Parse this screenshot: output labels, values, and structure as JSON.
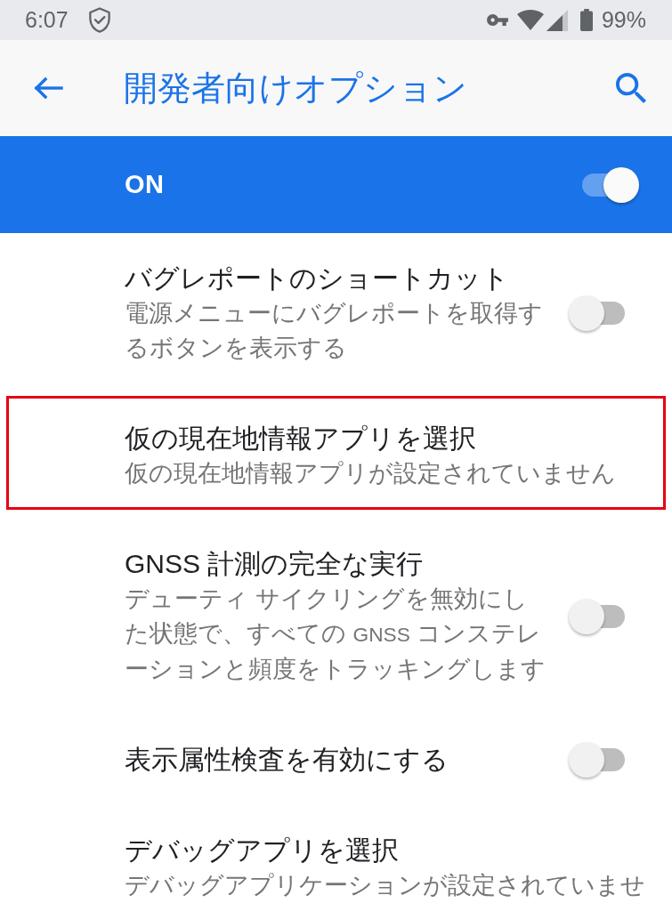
{
  "status_bar": {
    "time": "6:07",
    "battery": "99%"
  },
  "app_bar": {
    "title": "開発者向けオプション"
  },
  "master_switch": {
    "label": "ON",
    "on": true
  },
  "settings": [
    {
      "kind": "toggle",
      "title": "バグレポートのショートカット",
      "summary": "電源メニューにバグレポートを取得するボタンを表示する",
      "on": false,
      "highlighted": false
    },
    {
      "kind": "picker",
      "title": "仮の現在地情報アプリを選択",
      "summary": "仮の現在地情報アプリが設定されていません",
      "highlighted": true
    },
    {
      "kind": "toggle",
      "title": "GNSS 計測の完全な実行",
      "summary": "デューティ サイクリングを無効にした状態で、すべての GNSS コンステレーションと頻度をトラッキングします",
      "on": false,
      "highlighted": false
    },
    {
      "kind": "toggle",
      "title": "表示属性検査を有効にする",
      "on": false,
      "highlighted": false
    },
    {
      "kind": "picker",
      "title": "デバッグアプリを選択",
      "summary": "デバッグアプリケーションが設定されていませ",
      "highlighted": false
    }
  ]
}
